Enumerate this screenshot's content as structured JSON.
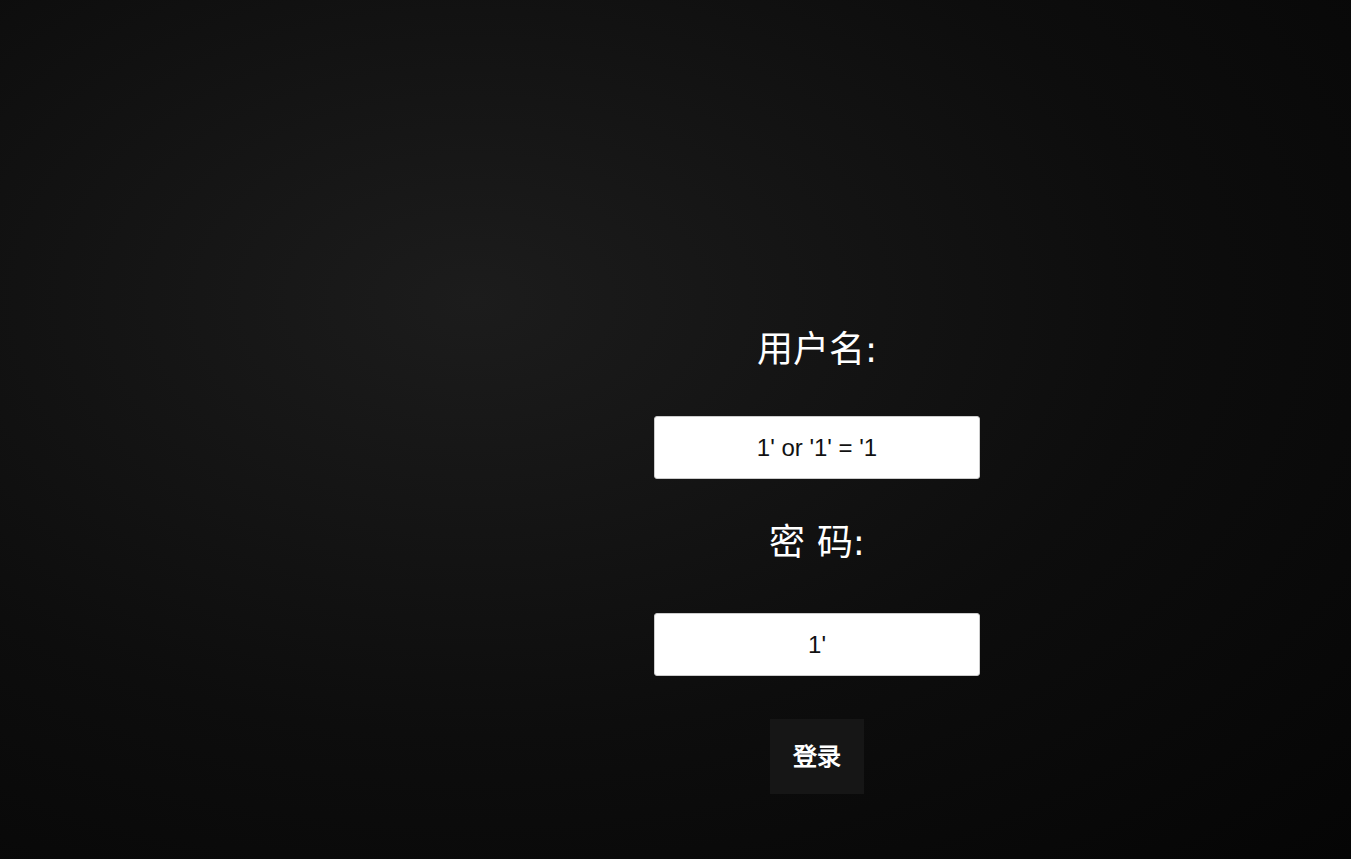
{
  "form": {
    "fields": [
      {
        "label": "用户名:",
        "value": "1' or '1' = '1"
      },
      {
        "label": "密 码:",
        "value": "1'"
      }
    ],
    "button": "登录"
  }
}
